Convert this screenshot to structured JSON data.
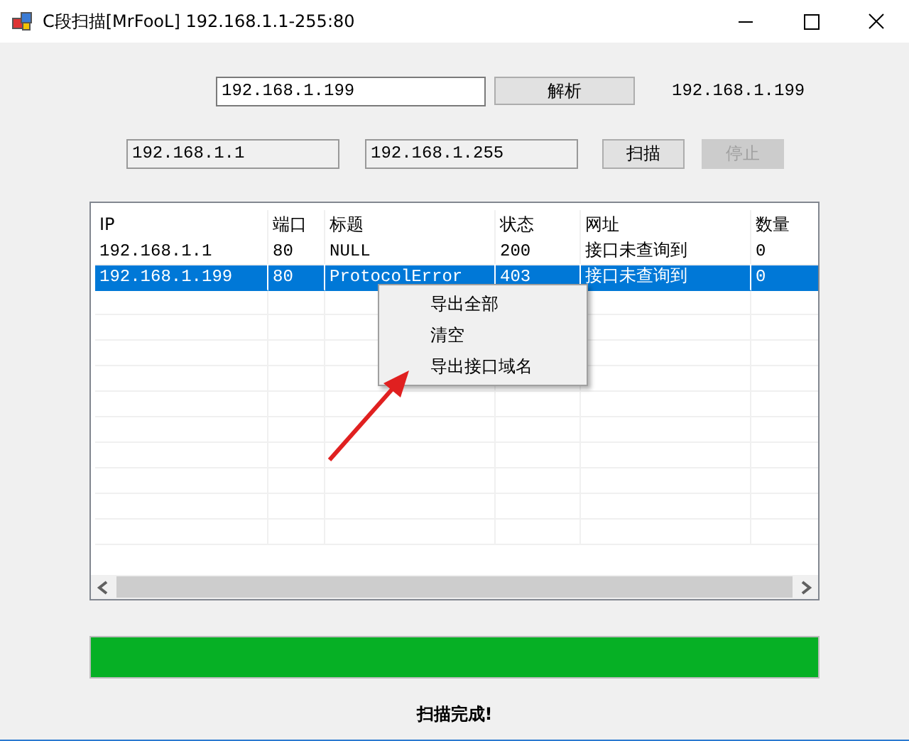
{
  "window": {
    "title": "C段扫描[MrFooL] 192.168.1.1-255:80"
  },
  "resolve": {
    "value": "192.168.1.199",
    "button": "解析",
    "result": "192.168.1.199"
  },
  "range": {
    "start": "192.168.1.1",
    "end": "192.168.1.255"
  },
  "buttons": [
    {
      "label": "扫描",
      "disabled": false
    },
    {
      "label": "停止",
      "disabled": true
    }
  ],
  "table": {
    "columns": [
      "IP",
      "端口",
      "标题",
      "状态",
      "网址",
      "数量"
    ],
    "rows": [
      {
        "cells": [
          "192.168.1.1",
          "80",
          "NULL",
          "200",
          "接口未查询到",
          "0"
        ],
        "selected": false
      },
      {
        "cells": [
          "192.168.1.199",
          "80",
          "ProtocolError",
          "403",
          "接口未查询到",
          "0"
        ],
        "selected": true
      }
    ]
  },
  "context_menu": {
    "items": [
      "导出全部",
      "清空",
      "导出接口域名"
    ]
  },
  "progress": {
    "level": 1
  },
  "status": "扫描完成!"
}
